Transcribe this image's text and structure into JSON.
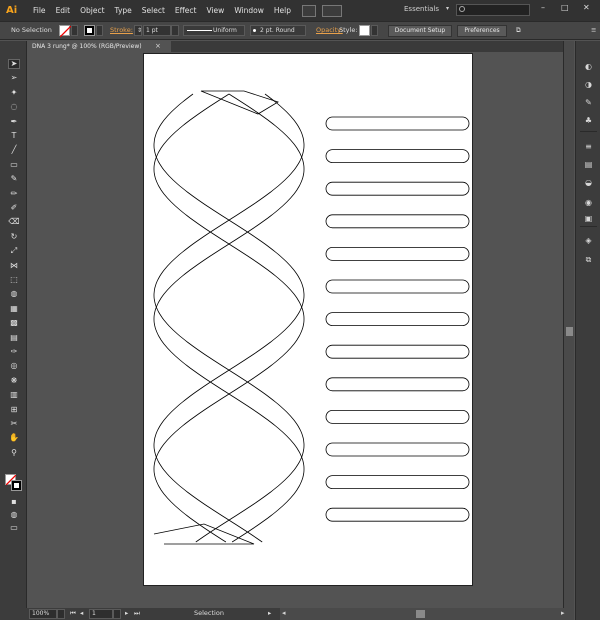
{
  "app": {
    "logo": "Ai"
  },
  "menu": {
    "items": [
      "File",
      "Edit",
      "Object",
      "Type",
      "Select",
      "Effect",
      "View",
      "Window",
      "Help"
    ]
  },
  "workspace": {
    "label": "Essentials",
    "caret": "▾"
  },
  "search": {
    "placeholder": ""
  },
  "window_controls": {
    "minimize": "–",
    "restore": "□",
    "close": "✕"
  },
  "control_bar": {
    "selection": "No Selection",
    "stroke_label": "Stroke:",
    "stroke_weight": "1 pt",
    "profile": "Uniform",
    "brush": "2 pt. Round",
    "opacity_label": "Opacity:",
    "style_label": "Style:",
    "document_setup": "Document Setup",
    "preferences": "Preferences"
  },
  "document_tab": {
    "title": "DNA 3 rung* @ 100% (RGB/Preview)",
    "close": "×"
  },
  "status_bar": {
    "zoom": "100%",
    "artboard": "1",
    "tool": "Selection"
  },
  "tools": [
    "selection-icon",
    "direct-selection-icon",
    "magic-wand-icon",
    "lasso-icon",
    "pen-icon",
    "type-icon",
    "line-icon",
    "rectangle-icon",
    "paintbrush-icon",
    "pencil-icon",
    "blob-brush-icon",
    "eraser-icon",
    "rotate-icon",
    "scale-icon",
    "width-icon",
    "free-transform-icon",
    "shape-builder-icon",
    "perspective-icon",
    "mesh-icon",
    "gradient-icon",
    "eyedropper-icon",
    "blend-icon",
    "symbol-sprayer-icon",
    "graph-icon",
    "artboard-icon",
    "slice-icon",
    "hand-icon",
    "zoom-icon"
  ],
  "dock": [
    "color-icon",
    "color-guide-icon",
    "brushes-icon",
    "symbols-icon",
    "stroke-icon",
    "gradient-icon",
    "transparency-icon",
    "appearance-icon",
    "graphic-styles-icon",
    "layers-icon",
    "artboards-icon"
  ],
  "colors": {
    "menubar": "#323232",
    "panel": "#3c3c3c",
    "canvas": "#535353",
    "artboard": "#ffffff",
    "logo": "#f7a31c"
  },
  "artwork": {
    "rung_count": 13
  }
}
